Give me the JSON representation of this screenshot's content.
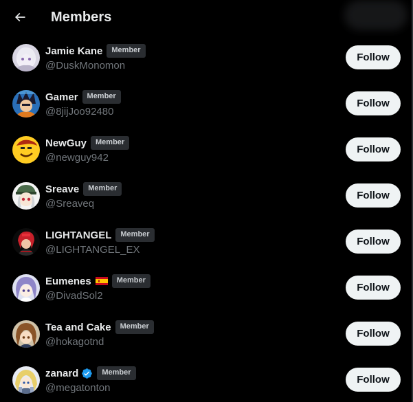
{
  "header": {
    "title": "Members",
    "back_icon": "arrow-left-icon"
  },
  "colors": {
    "background": "#000000",
    "text_primary": "#e7e9ea",
    "text_secondary": "#71767b",
    "badge_bg": "#2a2d31",
    "follow_bg": "#eff3f4",
    "verified": "#1d9bf0"
  },
  "members": [
    {
      "name": "Jamie Kane",
      "handle": "@DuskMonomon",
      "badge": "Member",
      "button": "Follow",
      "avatar": "avatar-white-hair-girl"
    },
    {
      "name": "Gamer",
      "handle": "@8jijJoo92480",
      "badge": "Member",
      "button": "Follow",
      "avatar": "avatar-spiky-hair-anime"
    },
    {
      "name": "NewGuy",
      "handle": "@newguy942",
      "badge": "Member",
      "button": "Follow",
      "avatar": "avatar-smiley-face"
    },
    {
      "name": "Sreave",
      "handle": "@Sreaveq",
      "badge": "Member",
      "button": "Follow",
      "avatar": "avatar-green-hat-chibi"
    },
    {
      "name": "LIGHTANGEL",
      "handle": "@LIGHTANGEL_EX",
      "badge": "Member",
      "button": "Follow",
      "avatar": "avatar-red-hair-character"
    },
    {
      "name": "Eumenes",
      "handle": "@DivadSol2",
      "badge": "Member",
      "button": "Follow",
      "avatar": "avatar-purple-hair-girl",
      "flag": "spain-flag-icon"
    },
    {
      "name": "Tea and Cake",
      "handle": "@hokagotnd",
      "badge": "Member",
      "button": "Follow",
      "avatar": "avatar-brown-hair-girl"
    },
    {
      "name": "zanard",
      "handle": "@megatonton",
      "badge": "Member",
      "button": "Follow",
      "avatar": "avatar-blonde-armored-girl",
      "verified": "verified-badge-icon"
    }
  ]
}
